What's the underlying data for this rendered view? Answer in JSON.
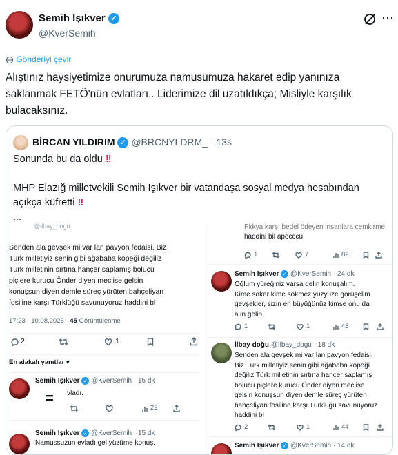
{
  "post": {
    "author_name": "Semih Işıkver",
    "author_handle": "@KverSemih",
    "translate_label": "Gönderiyi çevir",
    "text_line1": "Alıştınız haysiyetimize onurumuza namusumuza hakaret edip yanınıza",
    "text_line2": "saklanmak FETÖ'nün evlatları.. Liderimize dil uzatıldıkça; Misliyle karşılık",
    "text_line3": "bulacaksınız."
  },
  "quote": {
    "author_name": "BİRCAN YILDIRIM",
    "author_handle": "@BRCNYLDRM_",
    "time": "· 13s",
    "line1": "Sonunda bu da oldu",
    "line2": "MHP Elazığ milletvekili Semih Işıkver bir vatandaşa sosyal medya hesabından",
    "line3": "açıkça küfretti",
    "line4": "..."
  },
  "left_shot": {
    "top_handle": "@ilbay_dogu",
    "body": [
      "Senden ala gevşek mi var lan pavyon fedaisi. Biz",
      "Türk milletiyiz senin gibi ağababa köpeği değiliz",
      "Türk milletinin sırtına hançer saplamış bölücü",
      "piçlere kurucu Önder diyen meclise gelsin",
      "konuşsun diyen demle süreç yürüten bahçeliyan",
      "fosiline karşı Türklüğü savunuyoruz haddini bl"
    ],
    "meta_time": "17:23 · 10.08.2025 ·",
    "meta_views_count": "45",
    "meta_views_label": "Görüntülenme",
    "replies": "2",
    "likes": "1",
    "relevant_label": "En alakalı yanıtlar",
    "reply1": {
      "name": "Semih Işıkver",
      "handle": "@KverSemih · 15 dk",
      "text": "vladı.",
      "views": "22"
    },
    "reply2": {
      "name": "Semih Işıkver",
      "handle": "@KverSemih · 15 dk",
      "text": "Namussuzun evladı gel yüzüme konuş."
    }
  },
  "right_shot": {
    "top_line1": "Pkkya karşı bedel ödeyen insanlara çemkirme",
    "top_line2": "haddini bil apocccu",
    "top_replies": "1",
    "top_rts": "7",
    "top_views": "82",
    "r1": {
      "name": "Semih Işıkver",
      "handle": "@KverSemih · 24 dk",
      "body": [
        "Oğlum yüreğiniz varsa gelin konuşalım.",
        "Kime söker kime sökmez yüzyüze görüşelim",
        "gevşekler, sizin en büyüğünüz kimse onu da",
        "alın gelin."
      ],
      "replies": "1",
      "likes": "1",
      "views": "45"
    },
    "r2": {
      "name": "İlbay doğu",
      "handle": "@Ilbay_dogu · 18 dk",
      "body": [
        "Senden ala gevşek mi var lan pavyon fedaisi.",
        "Biz Türk milletiyiz senin gibi ağababa köpeği",
        "değiliz Türk milletinin sırtına hançer saplamış",
        "bölücü piçlere kurucu Önder diyen meclise",
        "gelsin konuşsun diyen demle süreç yürüten",
        "bahçeliyan fosiline karşı Türklüğü savunuyoruz",
        "haddini bl"
      ],
      "replies": "2",
      "likes": "1",
      "views": "44"
    },
    "r3": {
      "name": "Semih Işıkver",
      "handle": "@KverSemih · 14 dk"
    }
  },
  "colors": {
    "accent": "#1d9bf0",
    "muted": "#536471",
    "border": "#cfd9de",
    "alarm": "#e0245e"
  }
}
